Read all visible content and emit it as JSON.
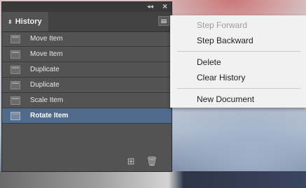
{
  "panel": {
    "title": "History",
    "collapse_icon": "double-chevron-left",
    "close_icon": "close-x",
    "items": [
      {
        "label": "Move Item",
        "selected": false
      },
      {
        "label": "Move Item",
        "selected": false
      },
      {
        "label": "Duplicate",
        "selected": false
      },
      {
        "label": "Duplicate",
        "selected": false
      },
      {
        "label": "Scale Item",
        "selected": false
      },
      {
        "label": "Rotate Item",
        "selected": true
      }
    ],
    "footer": {
      "new_icon": "new-document-icon",
      "delete_icon": "trash-icon"
    }
  },
  "flyout_menu": {
    "items": [
      {
        "label": "Step Forward",
        "enabled": false
      },
      {
        "label": "Step Backward",
        "enabled": true
      },
      {
        "label": "Delete",
        "enabled": true
      },
      {
        "label": "Clear History",
        "enabled": true
      },
      {
        "label": "New Document",
        "enabled": true
      }
    ]
  },
  "colors": {
    "panel_bg": "#535353",
    "selected_row": "#4f6a8a",
    "menu_bg": "#f1f1f1"
  }
}
